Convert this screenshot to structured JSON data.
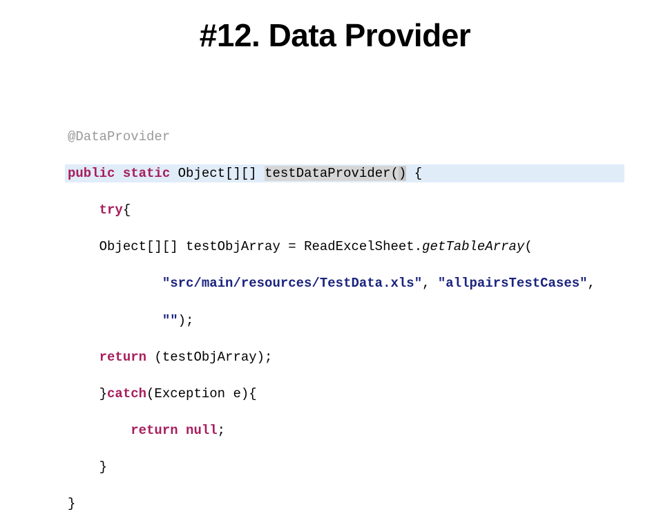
{
  "title": "#12. Data Provider",
  "code": {
    "annotation": "@DataProvider",
    "kw_public": "public",
    "kw_static": "static",
    "type_object": "Object",
    "brackets": "[][]",
    "method_name": "testDataProvider(",
    "method_close": ")",
    "brace_open": " {",
    "kw_try": "try",
    "try_brace": "{",
    "obj_decl": "Object",
    "obj_brackets": "[][]",
    "var_name": " testObjArray = ReadExcelSheet.",
    "get_table": "getTableArray",
    "call_open": "(",
    "str1": "\"src/main/resources/TestData.xls\"",
    "comma1": ", ",
    "str2": "\"allpairsTestCases\"",
    "comma2": ",",
    "str3": "\"\"",
    "call_close": ");",
    "kw_return": "return",
    "return_expr": " (testObjArray);",
    "catch_close": "}",
    "kw_catch": "catch",
    "catch_expr": "(Exception e){",
    "kw_return2": "return",
    "kw_null": "null",
    "semi": ";",
    "brace_close1": "}",
    "brace_close2": "}"
  }
}
